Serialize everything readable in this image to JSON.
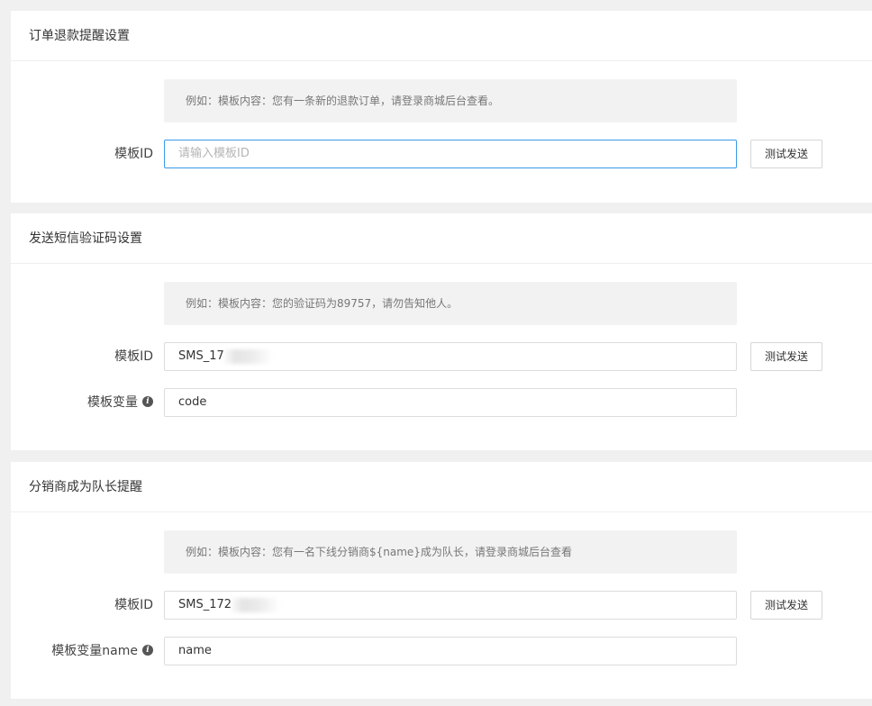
{
  "sections": [
    {
      "title": "订单退款提醒设置",
      "hint": "例如：模板内容：您有一条新的退款订单，请登录商城后台查看。",
      "template_id": {
        "label": "模板ID",
        "value": "",
        "placeholder": "请输入模板ID"
      },
      "test_button": "测试发送"
    },
    {
      "title": "发送短信验证码设置",
      "hint": "例如：模板内容：您的验证码为89757，请勿告知他人。",
      "template_id": {
        "label": "模板ID",
        "value": "SMS_17"
      },
      "test_button": "测试发送",
      "variable": {
        "label": "模板变量",
        "value": "code"
      }
    },
    {
      "title": "分销商成为队长提醒",
      "hint": "例如：模板内容：您有一名下线分销商${name}成为队长，请登录商城后台查看",
      "template_id": {
        "label": "模板ID",
        "value": "SMS_172"
      },
      "test_button": "测试发送",
      "variable": {
        "label": "模板变量name",
        "value": "name"
      }
    }
  ],
  "icons": {
    "info": "info-icon"
  }
}
